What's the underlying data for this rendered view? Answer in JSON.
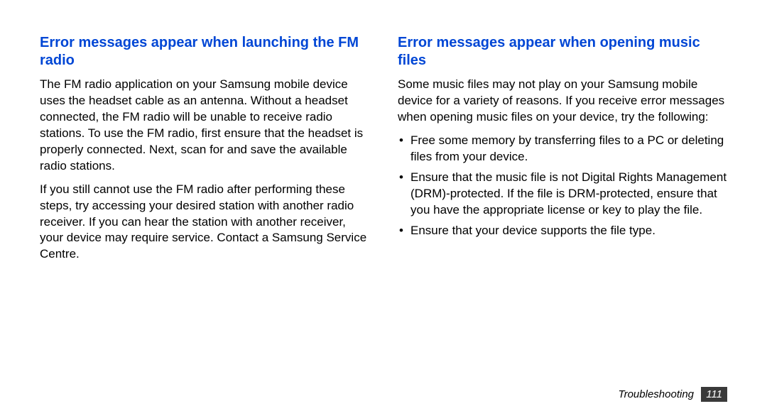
{
  "left": {
    "heading": "Error messages appear when launching the FM radio",
    "para1": "The FM radio application on your Samsung mobile device uses the headset cable as an antenna. Without a headset connected, the FM radio will be unable to receive radio stations. To use the FM radio, first ensure that the headset is properly connected. Next, scan for and save the available radio stations.",
    "para2": "If you still cannot use the FM radio after performing these steps, try accessing your desired station with another radio receiver. If you can hear the station with another receiver, your device may require service. Contact a Samsung Service Centre."
  },
  "right": {
    "heading": "Error messages appear when opening music files",
    "para1": "Some music files may not play on your Samsung mobile device for a variety of reasons. If you receive error messages when opening music files on your device, try the following:",
    "bullets": [
      "Free some memory by transferring files to a PC or deleting files from your device.",
      "Ensure that the music file is not Digital Rights Management (DRM)-protected. If the file is DRM-protected, ensure that you have the appropriate license or key to play the file.",
      "Ensure that your device supports the file type."
    ]
  },
  "footer": {
    "section": "Troubleshooting",
    "page": "111"
  }
}
